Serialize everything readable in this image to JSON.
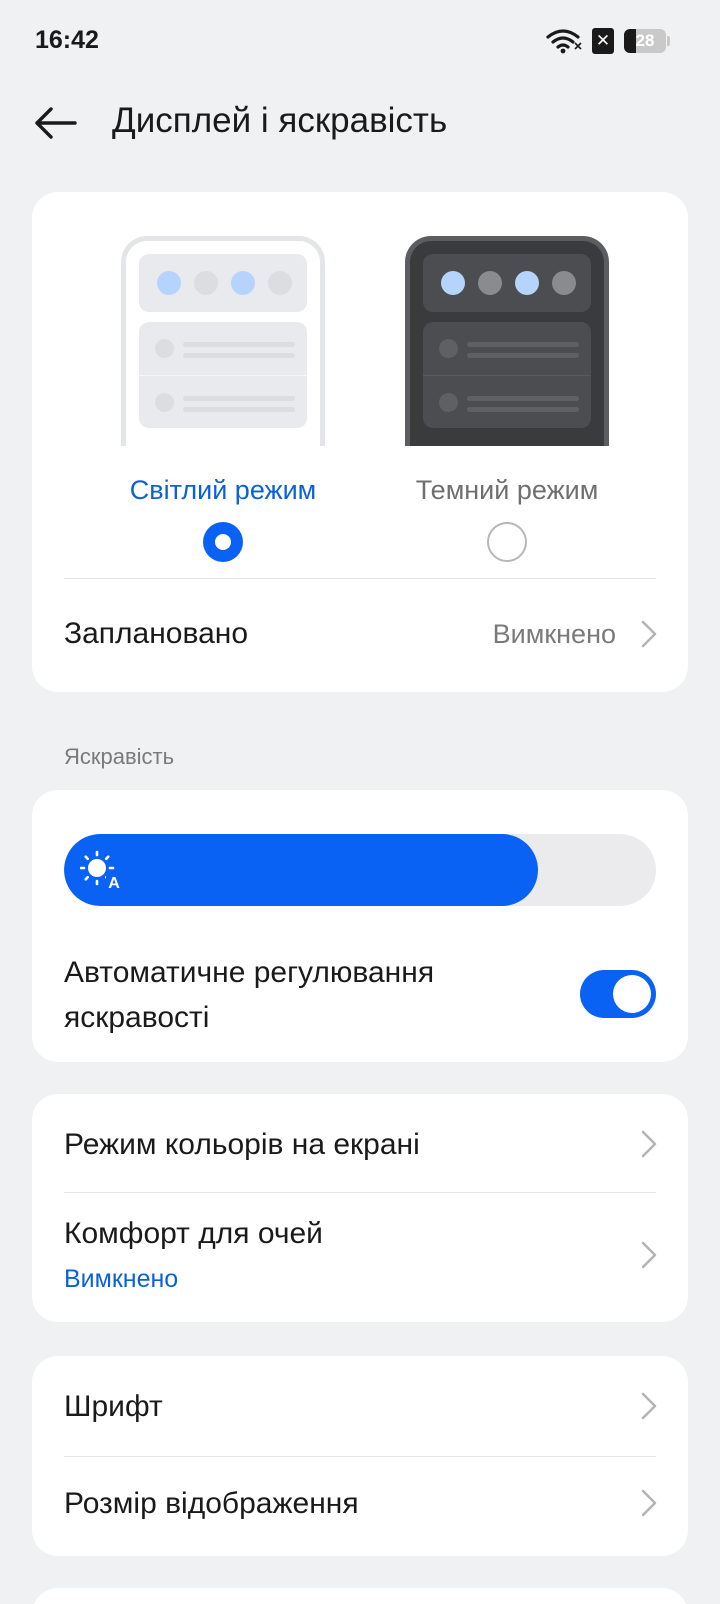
{
  "status_bar": {
    "time": "16:42",
    "battery_level": "28",
    "battery_percent": 28
  },
  "header": {
    "title": "Дисплей і яскравість"
  },
  "theme": {
    "light_label": "Світлий режим",
    "dark_label": "Темний режим",
    "selected": "light",
    "scheduled_label": "Заплановано",
    "scheduled_value": "Вимкнено"
  },
  "brightness": {
    "section_label": "Яскравість",
    "level_percent": 80,
    "auto_label": "Автоматичне регулювання яскравості",
    "auto_enabled": true
  },
  "display": {
    "color_mode_label": "Режим кольорів на екрані",
    "eye_comfort_label": "Комфорт для очей",
    "eye_comfort_value": "Вимкнено"
  },
  "text": {
    "font_label": "Шрифт",
    "display_size_label": "Розмір відображення"
  },
  "colors": {
    "accent": "#0a62f5",
    "accent_text": "#0a62d8",
    "background": "#f0f1f3"
  }
}
